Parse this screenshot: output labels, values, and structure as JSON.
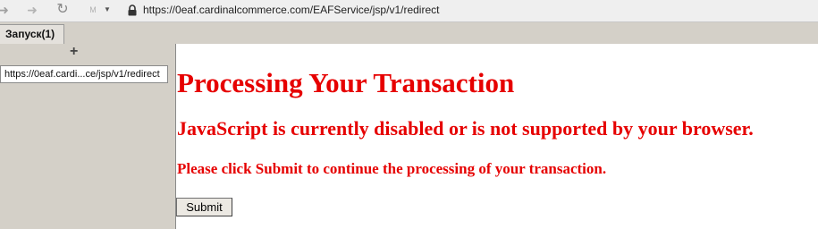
{
  "toolbar": {
    "back_icon": "back-arrow-icon",
    "forward_icon": "forward-arrow-icon",
    "reload_icon": "reload-icon",
    "m_label": "M",
    "dropdown_icon": "dropdown-icon",
    "lock_icon": "lock-icon",
    "url": "https://0eaf.cardinalcommerce.com/EAFService/jsp/v1/redirect"
  },
  "tabs": [
    {
      "label": "Запуск(1)"
    }
  ],
  "sidebar": {
    "add_label": "+",
    "frame_url": "https://0eaf.cardi...ce/jsp/v1/redirect"
  },
  "page": {
    "title": "Processing Your Transaction",
    "subtitle": "JavaScript is currently disabled or is not supported by your browser.",
    "note": "Please click Submit to continue the processing of your transaction.",
    "submit_label": "Submit"
  },
  "colors": {
    "heading_red": "#e60000",
    "chrome_gray": "#d4d0c8"
  }
}
